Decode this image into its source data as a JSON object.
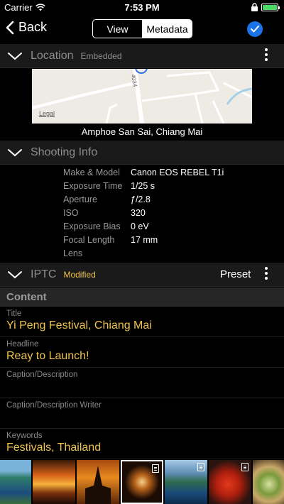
{
  "status": {
    "carrier": "Carrier",
    "time": "7:53 PM",
    "battery_level": 1.0,
    "battery_color": "#4cd964"
  },
  "nav": {
    "back_label": "Back",
    "segments": [
      {
        "label": "View",
        "selected": false
      },
      {
        "label": "Metadata",
        "selected": true
      }
    ],
    "done_icon": "checkmark-circle-icon",
    "accent_color": "#1a73e8"
  },
  "location": {
    "title": "Location",
    "subtitle": "Embedded",
    "map_legal": "Legal",
    "map_road_label": "4034",
    "place": "Amphoe San Sai, Chiang Mai"
  },
  "shooting": {
    "title": "Shooting Info",
    "rows": [
      {
        "label": "Make & Model",
        "value": "Canon EOS REBEL T1i"
      },
      {
        "label": "Exposure Time",
        "value": "1/25 s"
      },
      {
        "label": "Aperture",
        "value": "ƒ/2.8"
      },
      {
        "label": "ISO",
        "value": "320"
      },
      {
        "label": "Exposure Bias",
        "value": "0 eV"
      },
      {
        "label": "Focal Length",
        "value": "17 mm"
      },
      {
        "label": "Lens",
        "value": ""
      }
    ]
  },
  "iptc": {
    "title": "IPTC",
    "subtitle": "Modified",
    "preset_label": "Preset",
    "subtitle_color": "#f0c24b"
  },
  "content": {
    "title": "Content",
    "fields": [
      {
        "label": "Title",
        "value": "Yi Peng Festival, Chiang Mai"
      },
      {
        "label": "Headline",
        "value": "Reay to Launch!"
      },
      {
        "label": "Caption/Description",
        "value": ""
      },
      {
        "label": "Caption/Description Writer",
        "value": ""
      },
      {
        "label": "Keywords",
        "value": "Festivals, Thailand"
      }
    ]
  },
  "filmstrip": {
    "thumbnails": [
      {
        "name": "coast",
        "selected": false,
        "has_metadata": false
      },
      {
        "name": "sunset",
        "selected": false,
        "has_metadata": false
      },
      {
        "name": "temple",
        "selected": false,
        "has_metadata": false
      },
      {
        "name": "lantern",
        "selected": true,
        "has_metadata": true
      },
      {
        "name": "bay",
        "selected": false,
        "has_metadata": true
      },
      {
        "name": "food-red",
        "selected": false,
        "has_metadata": true
      },
      {
        "name": "salad",
        "selected": false,
        "has_metadata": false
      }
    ]
  }
}
